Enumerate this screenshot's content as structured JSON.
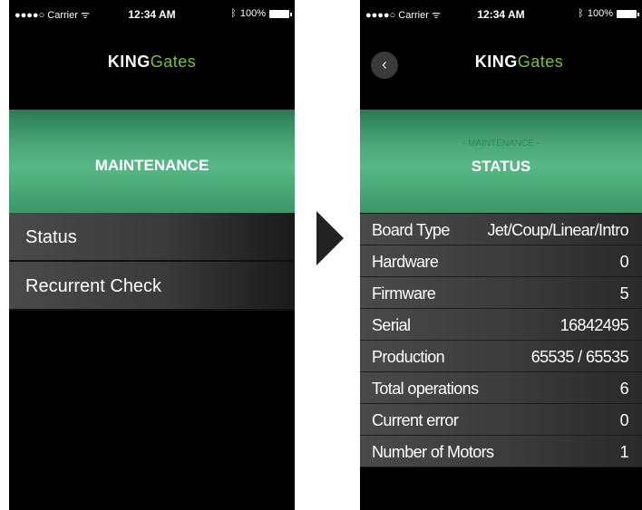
{
  "status_bar": {
    "carrier": "●●●●○ Carrier ᯤ",
    "time": "12:34 AM",
    "battery": "100%"
  },
  "logo": {
    "king": "KING",
    "gates": "Gates"
  },
  "left_screen": {
    "banner_title": "MAINTENANCE",
    "menu": [
      {
        "label": "Status"
      },
      {
        "label": "Recurrent Check"
      }
    ]
  },
  "right_screen": {
    "banner_subtitle": "- MAINTENANCE -",
    "banner_title": "STATUS",
    "rows": [
      {
        "label": "Board Type",
        "value": "Jet/Coup/Linear/Intro"
      },
      {
        "label": "Hardware",
        "value": "0"
      },
      {
        "label": "Firmware",
        "value": "5"
      },
      {
        "label": "Serial",
        "value": "16842495"
      },
      {
        "label": "Production",
        "value": "65535 / 65535"
      },
      {
        "label": "Total operations",
        "value": "6"
      },
      {
        "label": "Current error",
        "value": "0"
      },
      {
        "label": "Number of Motors",
        "value": "1"
      }
    ]
  },
  "icons": {
    "bluetooth": "bluetooth-icon",
    "battery": "battery-icon",
    "back": "back-chevron-icon",
    "transition_arrow": "arrow-right-icon"
  },
  "colors": {
    "accent_green": "#58b886",
    "logo_green": "#7dbf3a",
    "background": "#000000"
  }
}
